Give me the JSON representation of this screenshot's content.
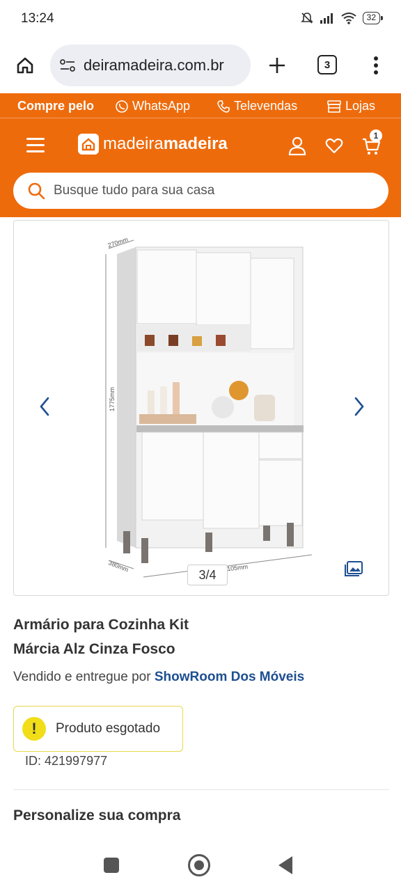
{
  "status_bar": {
    "time": "13:24",
    "battery": "32",
    "icons": [
      "mute-bell-icon",
      "signal-icon",
      "wifi-icon",
      "battery-icon"
    ]
  },
  "browser": {
    "url": "madeiramadeira.com.br",
    "url_visible": "̣deiramadeira.com.br",
    "tab_count": "3"
  },
  "site_header": {
    "strip": {
      "compre_label": "Compre pelo",
      "whatsapp_label": "WhatsApp",
      "televendas_label": "Televendas",
      "lojas_label": "Lojas"
    },
    "logo_part1": "madeira",
    "logo_part2": "madeira",
    "cart_count": "1",
    "search_placeholder": "Busque tudo para sua casa",
    "accent_color": "#ee6b0c"
  },
  "gallery": {
    "counter": "3/4",
    "dimensions": {
      "depth_top": "270mm",
      "height": "1775mm",
      "depth_bottom": "380mm",
      "width": "105mm"
    }
  },
  "product": {
    "title": "Armário para Cozinha Kit Márcia Alz Cinza Fosco",
    "seller_prefix": "Vendido e entregue por",
    "seller_name": "ShowRoom Dos Móveis",
    "stock_status": "Produto esgotado",
    "id_line": "ID: 421997977",
    "personalize_heading": "Personalize sua compra"
  }
}
